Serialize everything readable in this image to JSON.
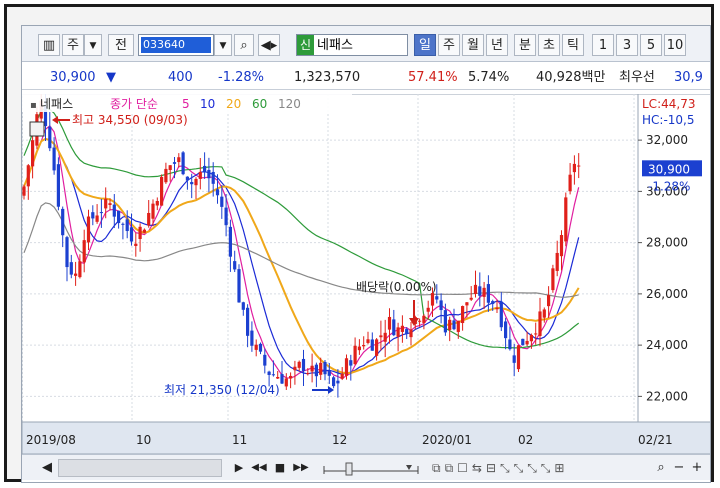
{
  "toolbar": {
    "market": "주",
    "prev": "전",
    "code": "033640",
    "stock_tag": "신",
    "stock_name": "네패스",
    "periods": [
      "일",
      "주",
      "월",
      "년",
      "분",
      "초",
      "틱"
    ],
    "active_period": "일",
    "intervals": [
      "1",
      "3",
      "5",
      "10"
    ]
  },
  "quote": {
    "price": "30,900",
    "change": "400",
    "change_pct": "-1.28%",
    "volume": "1,323,570",
    "ratio1": "57.41%",
    "ratio2": "5.74%",
    "amount": "40,928백만",
    "best_label": "최우선",
    "best_value": "30,9"
  },
  "legend": {
    "name": "네패스",
    "title": "종가 단순",
    "ma": [
      {
        "label": "5",
        "color": "#e01fa0"
      },
      {
        "label": "10",
        "color": "#1c2bd6"
      },
      {
        "label": "20",
        "color": "#f0a81a"
      },
      {
        "label": "60",
        "color": "#2e9b3a"
      },
      {
        "label": "120",
        "color": "#888888"
      }
    ]
  },
  "limits": {
    "lc": "LC:44,73",
    "hc": "HC:-10,5"
  },
  "annotations": {
    "high": "최고 34,550 (09/03)",
    "low": "최저 21,350 (12/04)",
    "dividend": "배당락(0.00%)"
  },
  "price_tag": {
    "price": "30,900",
    "pct": "-1.28%"
  },
  "chart_data": {
    "type": "candlestick",
    "y_ticks": [
      "32,000",
      "30,000",
      "28,000",
      "26,000",
      "24,000",
      "22,000"
    ],
    "y_range": [
      21000,
      33800
    ],
    "x_ticks": [
      "2019/08",
      "10",
      "11",
      "12",
      "2020/01",
      "02",
      "02/21"
    ],
    "last_close": 30900,
    "high": 34550,
    "low": 21350
  },
  "colors": {
    "up": "#e0201a",
    "down": "#1c40d0"
  },
  "scroll": {
    "left": "◀",
    "play": "▶",
    "prev": "◀◀",
    "stop": "■",
    "next": "▶▶",
    "minus": "−",
    "plus": "+"
  }
}
